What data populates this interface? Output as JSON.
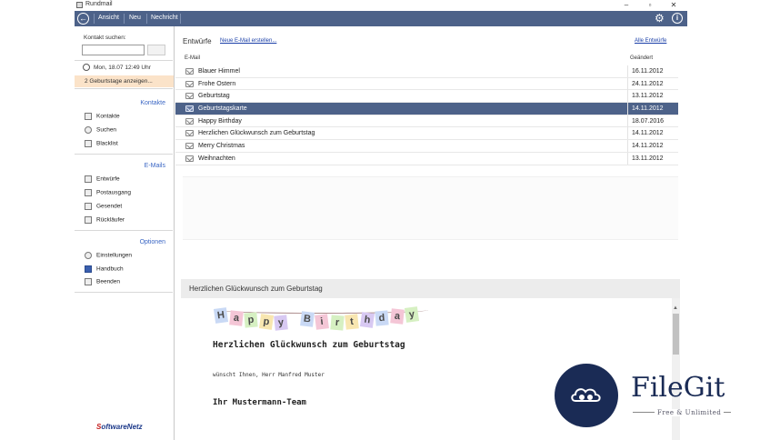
{
  "window": {
    "title": "Rundmail"
  },
  "toolbar": {
    "buttons": [
      "Ansicht",
      "Neu",
      "Nechricht"
    ]
  },
  "sidebar": {
    "search_label": "Kontakt suchen:",
    "search_value": "",
    "datetime": "Mon, 18.07   12:49 Uhr",
    "birthday_notice": "2 Geburtstage anzeigen...",
    "sections": {
      "kontakte": {
        "title": "Kontakte",
        "items": [
          "Kontakte",
          "Suchen",
          "Blacklist"
        ]
      },
      "emails": {
        "title": "E-Mails",
        "items": [
          "Entwürfe",
          "Postausgang",
          "Gesendet",
          "Rückläufer"
        ]
      },
      "optionen": {
        "title": "Optionen",
        "items": [
          "Einstellungen",
          "Handbuch",
          "Beenden"
        ]
      }
    },
    "logo": {
      "first": "S",
      "rest": "oftwareNetz"
    }
  },
  "main": {
    "heading": "Entwürfe",
    "new_link": "Neue E-Mail erstellen...",
    "all_link": "Alle Entwürfe",
    "columns": {
      "email": "E-Mail",
      "date": "Geändert"
    },
    "rows": [
      {
        "subject": "Blauer Himmel",
        "date": "16.11.2012"
      },
      {
        "subject": "Frohe Ostern",
        "date": "24.11.2012"
      },
      {
        "subject": "Geburtstag",
        "date": "13.11.2012"
      },
      {
        "subject": "Geburtstagskarte",
        "date": "14.11.2012"
      },
      {
        "subject": "Happy Birthday",
        "date": "18.07.2016"
      },
      {
        "subject": "Herzlichen Glückwunsch zum Geburtstag",
        "date": "14.11.2012"
      },
      {
        "subject": "Merry Christmas",
        "date": "14.11.2012"
      },
      {
        "subject": "Weihnachten",
        "date": "13.11.2012"
      }
    ],
    "selected_index": 3
  },
  "preview": {
    "header": "Herzlichen Glückwunsch zum Geburtstag",
    "banner_letters": [
      "H",
      "a",
      "p",
      "p",
      "y",
      "B",
      "i",
      "r",
      "t",
      "h",
      "d",
      "a",
      "y"
    ],
    "banner_colors": [
      "#c9d9f5",
      "#f4c6d6",
      "#d6f0c2",
      "#f8e6b0",
      "#d8c9f2",
      "#c9d9f5",
      "#f4c6d6",
      "#d6f0c2",
      "#f8e6b0",
      "#d8c9f2",
      "#c9d9f5",
      "#f4c6d6",
      "#d6f0c2"
    ],
    "title": "Herzlichen Glückwunsch zum Geburtstag",
    "subtitle": "wünscht Ihnen, Herr Manfred Muster",
    "signature": "Ihr Mustermann-Team"
  },
  "watermark": {
    "name": "FileGit",
    "tagline": "Free & Unlimited"
  },
  "colors": {
    "accent": "#4d6289",
    "link": "#1a3fa8",
    "section": "#3a66c4",
    "highlight": "#fbe3c9"
  }
}
